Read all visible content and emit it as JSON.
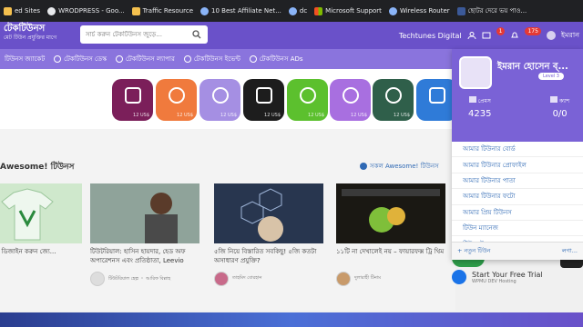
{
  "bookmarks": [
    {
      "label": "ed Sites",
      "icon": "folder-icon"
    },
    {
      "label": "WRODPRESS - Goo...",
      "icon": "wordpress-icon"
    },
    {
      "label": "Traffic Resource",
      "icon": "folder-icon"
    },
    {
      "label": "10 Best Affiliate Net...",
      "icon": "globe-icon"
    },
    {
      "label": "dc",
      "icon": "globe-icon"
    },
    {
      "label": "Microsoft Support",
      "icon": "microsoft-icon"
    },
    {
      "label": "Wireless Router",
      "icon": "globe-icon"
    },
    {
      "label": "ছোটর দেরে ভয় পাও...",
      "icon": "globe-icon"
    }
  ],
  "header": {
    "logo_title": "টেকটিউনস",
    "logo_sub": "মেট টিউন প্রযুক্তির মাগে",
    "search_placeholder": "সার্চ করুন টেকটিউনস জুড়ে...",
    "site_name": "Techtunes Digital",
    "badge_a": "1",
    "badge_b": "175",
    "user_short": "ইমরান"
  },
  "nav": [
    "টিউনস জ্যাকেট",
    "টেকটিউনস ডেস্ক",
    "টেকটিউনস ল্যাপার",
    "টেকটিউনস ইভেন্ট",
    "টেকটিউনস ADs"
  ],
  "tiles": [
    {
      "color": "#7b1f5a",
      "price": "12 US$",
      "icon": "image-frame-icon"
    },
    {
      "color": "#f07a3d",
      "price": "12 US$",
      "icon": "globe-icon"
    },
    {
      "color": "#a58fe3",
      "price": "12 US$",
      "icon": "at-sign-icon"
    },
    {
      "color": "#1d1d1d",
      "price": "12 US$",
      "icon": "magic-wand-icon"
    },
    {
      "color": "#5cc02e",
      "price": "12 US$",
      "icon": "gauge-icon"
    },
    {
      "color": "#a86fe0",
      "price": "12 US$",
      "icon": "cloud-icon"
    },
    {
      "color": "#2f5f4a",
      "price": "12 US$",
      "icon": "refresh-icon"
    },
    {
      "color": "#2f7bd8",
      "price": "",
      "icon": "m-logo-icon"
    }
  ],
  "section": {
    "title": "Awesome! টিউনস",
    "link": "সকল Awesome! টিউনস"
  },
  "cards": [
    {
      "title": "কট টি-শার্ট ডিজাইন করুন জ্যে...",
      "author": "",
      "thumb": "#cfe8cc"
    },
    {
      "title": "টিউটরিয়াল: হাসিন হায়দার, হেড অফ অপারেশনস এবং প্রতিষ্ঠাতা, Leevio",
      "author": "টিউটরিয়াল হেল্প ・ আরিফ বিল্লাহ",
      "thumb": "#7a8f86"
    },
    {
      "title": "৫জি নিয়ে বিস্তারিত সবকিছু! ৫জি কতটা অসাধারণ প্রযুক্তি?",
      "author": "তাহমিদ বোরহান",
      "thumb": "#2a3b56"
    },
    {
      "title": "১১টি না দেখালেই নয় – ফায়ারফক্স ট্রি থিম",
      "author": "দুলারাহী টিনাম",
      "thumb": "#2e2a24"
    }
  ],
  "dropdown": {
    "name": "ইমরান হোসেন ব্...",
    "level": "Level 3",
    "stat_left_label": "প্রেমস",
    "stat_left_value": "4235",
    "stat_right_label": "ক্যাশ",
    "stat_right_value": "0/0",
    "items": [
      "আমার টিউনার বোর্ড",
      "আমার টিউনার প্রোফাইল",
      "আমার টিউনার পাতা",
      "আমার টিউনার ফটো",
      "আমার প্রিয় টিউনস",
      "টিউন ম্যানেজ",
      "টিউমেন্ট ম্যানেজ"
    ],
    "new_tune": "+ নতুন টিউন",
    "logout": "লগা..."
  },
  "ad": {
    "title": "Start Your Free Trial",
    "sub": "WPMU DEV Hosting"
  },
  "colors": {
    "header": "#6a51c9",
    "nav": "#8a74dd",
    "link": "#2f69b4"
  }
}
